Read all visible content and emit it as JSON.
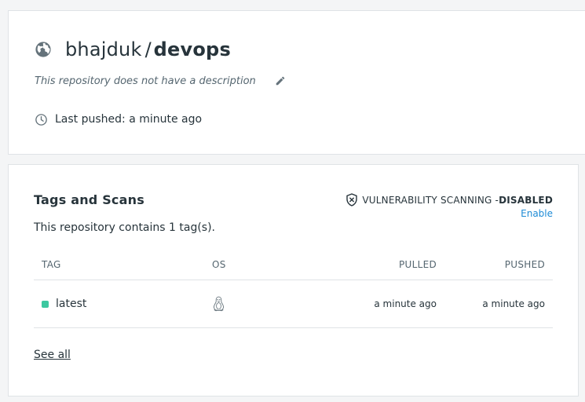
{
  "repo": {
    "owner": "bhajduk",
    "separator": "/",
    "name": "devops",
    "description": "This repository does not have a description",
    "last_pushed": "Last pushed: a minute ago"
  },
  "tags_section": {
    "heading": "Tags and Scans",
    "count_text": "This repository contains 1 tag(s).",
    "vuln_label": "VULNERABILITY SCANNING - ",
    "vuln_status": "DISABLED",
    "enable_label": "Enable",
    "columns": {
      "tag": "TAG",
      "os": "OS",
      "pulled": "PULLED",
      "pushed": "PUSHED"
    },
    "rows": [
      {
        "tag": "latest",
        "os_icon": "linux-icon",
        "pulled": "a minute ago",
        "pushed": "a minute ago",
        "status_color": "#3cc8a0"
      }
    ],
    "see_all_label": "See all"
  },
  "colors": {
    "link": "#1d8bd6",
    "text": "#27343b",
    "muted": "#556670",
    "border": "#dfe3e6"
  }
}
